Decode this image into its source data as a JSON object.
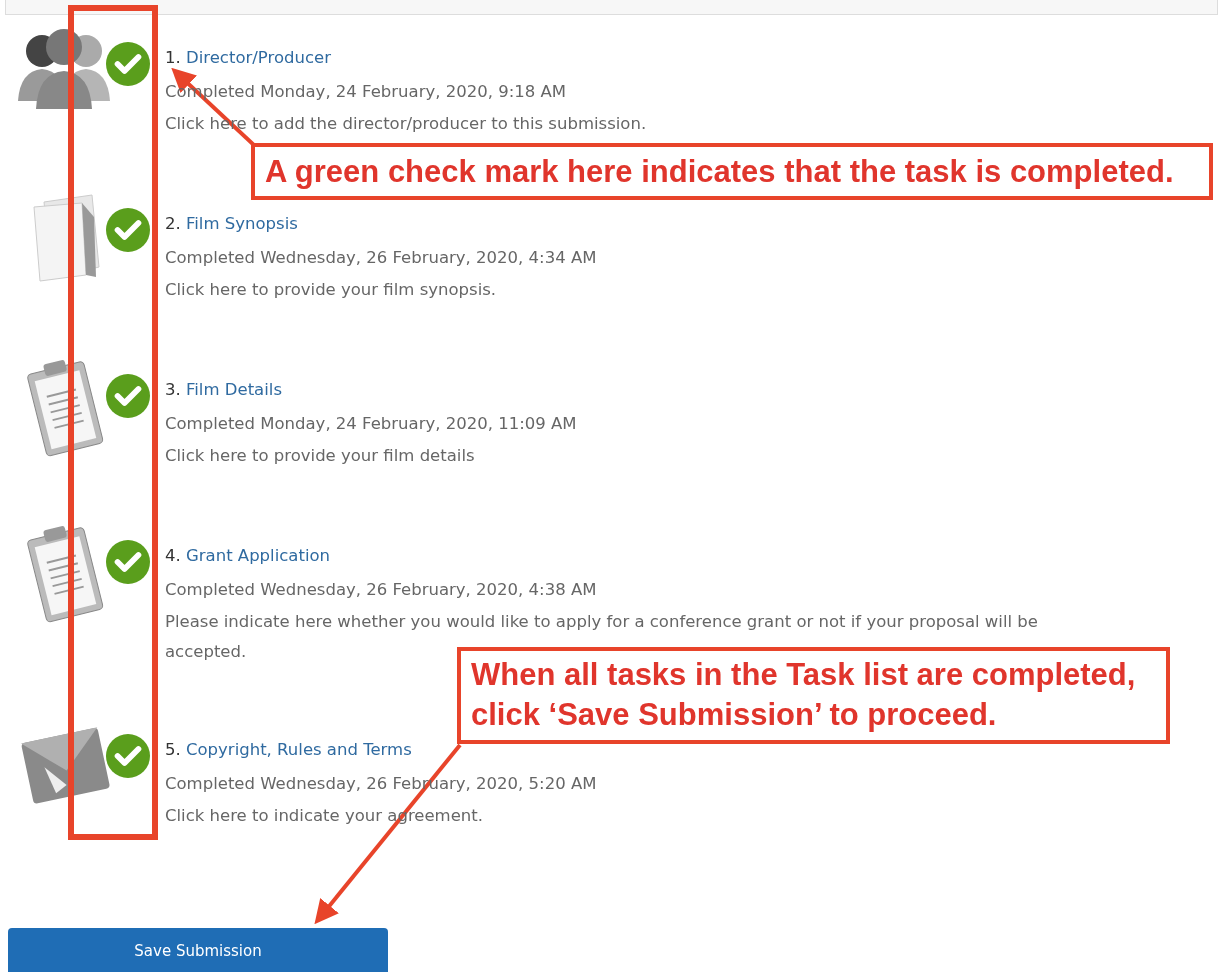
{
  "tasks": [
    {
      "number": "1.",
      "title": "Director/Producer",
      "completed": true,
      "status": "Completed Monday, 24 February, 2020, 9:18 AM",
      "description": "Click here to add the director/producer to this submission.",
      "kind": "people"
    },
    {
      "number": "2.",
      "title": "Film Synopsis",
      "completed": true,
      "status": "Completed Wednesday, 26 February, 2020, 4:34 AM",
      "description": "Click here to provide your film synopsis.",
      "kind": "pages"
    },
    {
      "number": "3.",
      "title": "Film Details",
      "completed": true,
      "status": "Completed Monday, 24 February, 2020, 11:09 AM",
      "description": "Click here to provide your film details",
      "kind": "clipboard"
    },
    {
      "number": "4.",
      "title": "Grant Application",
      "completed": true,
      "status": "Completed Wednesday, 26 February, 2020, 4:38 AM",
      "description": "Please indicate here whether you would like to apply for a conference grant or not if your proposal will be accepted.",
      "kind": "clipboard"
    },
    {
      "number": "5.",
      "title": "Copyright, Rules and Terms",
      "completed": true,
      "status": "Completed Wednesday, 26 February, 2020, 5:20 AM",
      "description": "Click here to indicate your agreement.",
      "kind": "envelope"
    }
  ],
  "save_button": "Save Submission",
  "annotations": [
    {
      "text": "A green check mark here indicates that the task is completed."
    },
    {
      "text": "When all tasks in the Task list are completed, click ‘Save Submission’  to proceed."
    }
  ]
}
